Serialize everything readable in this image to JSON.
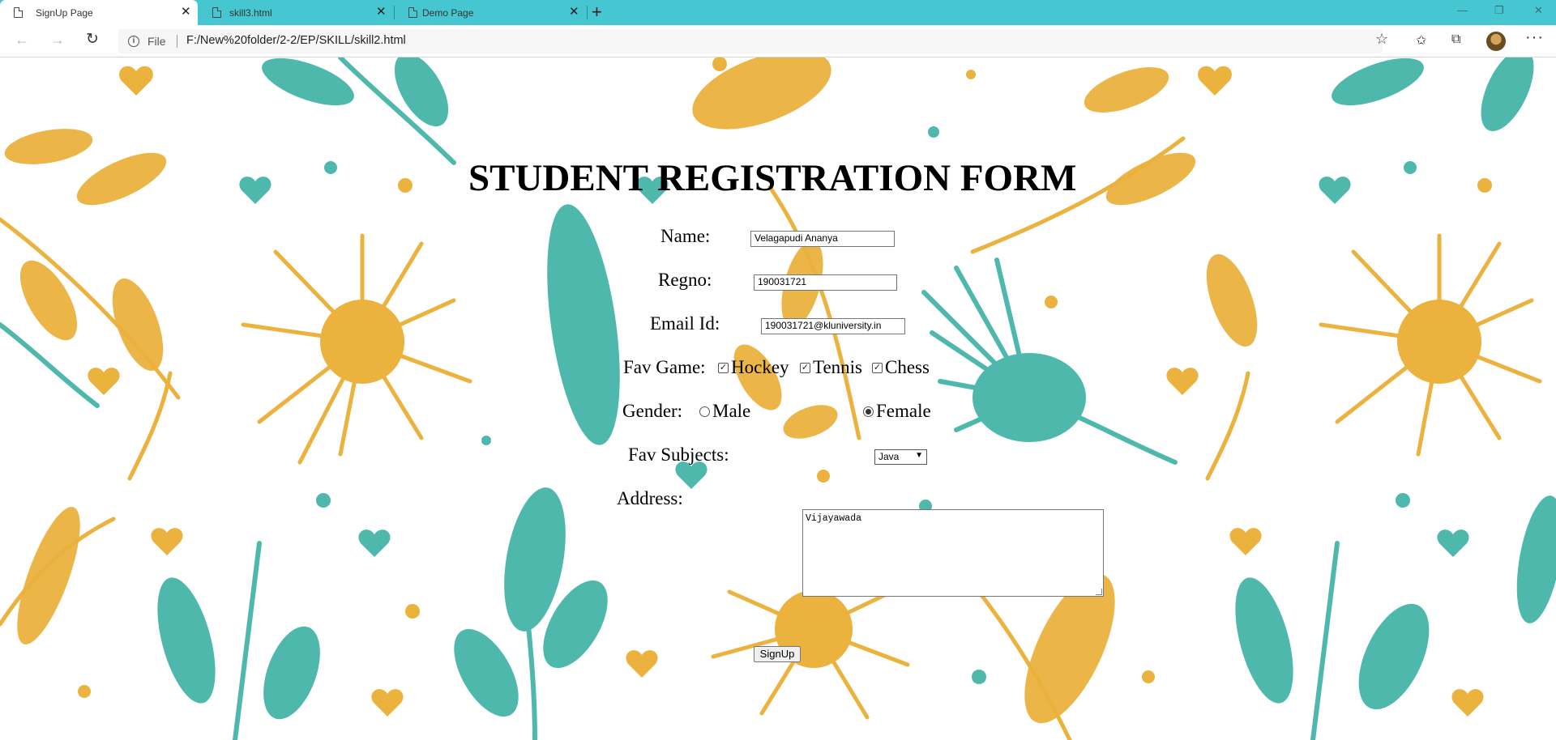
{
  "browser": {
    "tabs": [
      {
        "label": "SignUp Page"
      },
      {
        "label": "skill3.html"
      },
      {
        "label": "Demo Page"
      }
    ],
    "url_scheme": "File",
    "url": "F:/New%20folder/2-2/EP/SKILL/skill2.html"
  },
  "form": {
    "title": "STUDENT REGISTRATION FORM",
    "name": {
      "label": "Name:",
      "value": "Velagapudi Ananya"
    },
    "regno": {
      "label": "Regno:",
      "value": "190031721"
    },
    "email": {
      "label": "Email Id:",
      "value": "190031721@kluniversity.in"
    },
    "fav_game": {
      "label": "Fav Game:",
      "options": [
        {
          "label": "Hockey",
          "checked": true
        },
        {
          "label": "Tennis",
          "checked": true
        },
        {
          "label": "Chess",
          "checked": true
        }
      ]
    },
    "gender": {
      "label": "Gender:",
      "options": [
        {
          "label": "Male",
          "selected": false
        },
        {
          "label": "Female",
          "selected": true
        }
      ]
    },
    "fav_subjects": {
      "label": "Fav Subjects:",
      "selected": "Java"
    },
    "address": {
      "label": "Address:",
      "value": "Vijayawada"
    },
    "submit_label": "SignUp"
  },
  "colors": {
    "tabstrip": "#46c6d0",
    "floral_yellow": "#ebb23e",
    "floral_teal": "#4fb8ad"
  }
}
